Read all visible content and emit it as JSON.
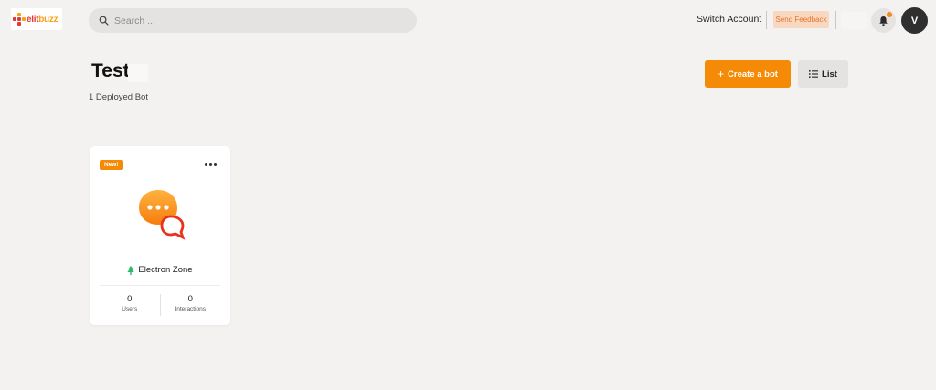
{
  "brand": {
    "logo_text_a": "elit",
    "logo_text_b": "buzz"
  },
  "search": {
    "placeholder": "Search ..."
  },
  "header": {
    "switch_account": "Switch Account",
    "send_feedback": "Send Feedback",
    "avatar_initial": "V"
  },
  "page": {
    "title": "Test",
    "subtitle": "1 Deployed Bot",
    "create_button": "Create a bot",
    "list_button": "List"
  },
  "bots": [
    {
      "badge": "New!",
      "name": "Electron Zone",
      "users_value": "0",
      "users_label": "Users",
      "interactions_value": "0",
      "interactions_label": "Interactions"
    }
  ],
  "colors": {
    "accent": "#f58a07",
    "background": "#f3f2f1",
    "avatar": "#2f2f2f",
    "notification_dot": "#f58a1f"
  },
  "icons": [
    "search-icon",
    "bell-icon",
    "plus-icon",
    "list-icon",
    "more-icon",
    "chat-bubble-icon",
    "tree-icon"
  ]
}
